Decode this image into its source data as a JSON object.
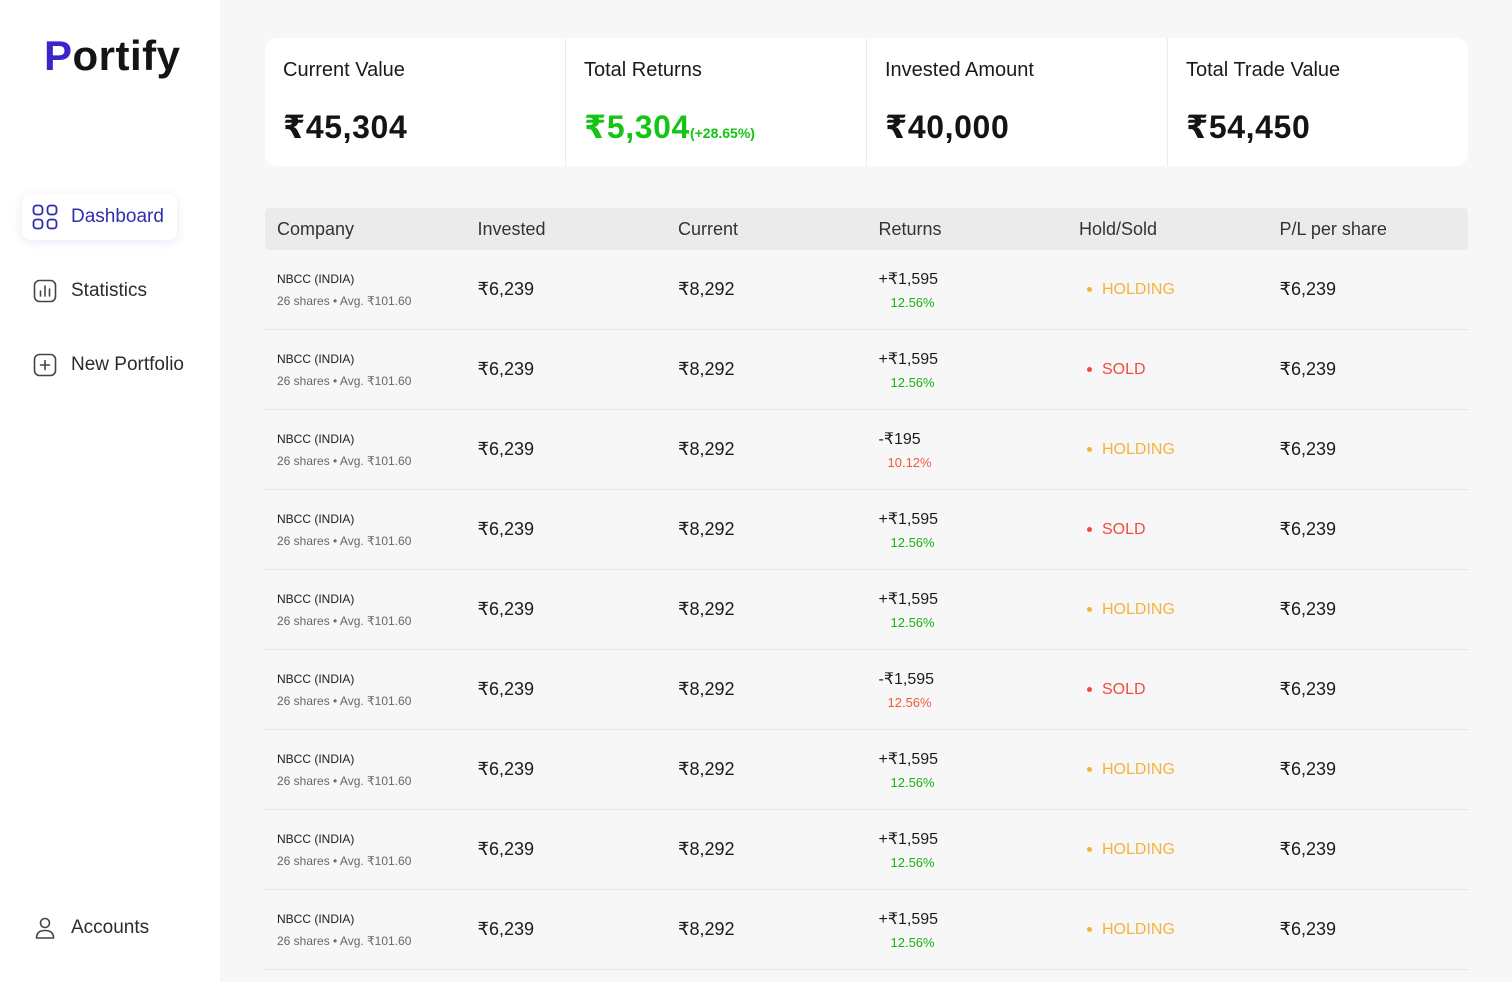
{
  "app": {
    "logo": "Portify",
    "logo_first": "P",
    "logo_rest": "ortify"
  },
  "sidebar": {
    "items": [
      {
        "label": "Dashboard",
        "icon": "grid-icon",
        "active": true
      },
      {
        "label": "Statistics",
        "icon": "bar-chart-icon",
        "active": false
      },
      {
        "label": "New Portfolio",
        "icon": "plus-square-icon",
        "active": false
      }
    ],
    "accounts": {
      "label": "Accounts",
      "icon": "user-icon"
    }
  },
  "summary": {
    "current_value": {
      "title": "Current Value",
      "value": "₹45,304"
    },
    "total_returns": {
      "title": "Total Returns",
      "value": "₹5,304",
      "percent": "(+28.65%)"
    },
    "invested_amount": {
      "title": "Invested Amount",
      "value": "₹40,000"
    },
    "total_trade_value": {
      "title": "Total Trade Value",
      "value": "₹54,450"
    }
  },
  "colors": {
    "accent": "#3b25c9",
    "positive": "#16c416",
    "negative": "#ef5a3c",
    "holding": "#f3b33d",
    "sold": "#ef4c3a"
  },
  "table": {
    "headers": [
      "Company",
      "Invested",
      "Current",
      "Returns",
      "Hold/Sold",
      "P/L per share"
    ],
    "rows": [
      {
        "company": "NBCC (INDIA)",
        "details": "26 shares • Avg. ₹101.60",
        "invested": "₹6,239",
        "current": "₹8,292",
        "returns": "+₹1,595",
        "returns_pct": "12.56%",
        "direction": "up",
        "status": "HOLDING",
        "pl": "₹6,239"
      },
      {
        "company": "NBCC (INDIA)",
        "details": "26 shares • Avg. ₹101.60",
        "invested": "₹6,239",
        "current": "₹8,292",
        "returns": "+₹1,595",
        "returns_pct": "12.56%",
        "direction": "up",
        "status": "SOLD",
        "pl": "₹6,239"
      },
      {
        "company": "NBCC (INDIA)",
        "details": "26 shares • Avg. ₹101.60",
        "invested": "₹6,239",
        "current": "₹8,292",
        "returns": "-₹195",
        "returns_pct": "10.12%",
        "direction": "down",
        "status": "HOLDING",
        "pl": "₹6,239"
      },
      {
        "company": "NBCC (INDIA)",
        "details": "26 shares • Avg. ₹101.60",
        "invested": "₹6,239",
        "current": "₹8,292",
        "returns": "+₹1,595",
        "returns_pct": "12.56%",
        "direction": "up",
        "status": "SOLD",
        "pl": "₹6,239"
      },
      {
        "company": "NBCC (INDIA)",
        "details": "26 shares • Avg. ₹101.60",
        "invested": "₹6,239",
        "current": "₹8,292",
        "returns": "+₹1,595",
        "returns_pct": "12.56%",
        "direction": "up",
        "status": "HOLDING",
        "pl": "₹6,239"
      },
      {
        "company": "NBCC (INDIA)",
        "details": "26 shares • Avg. ₹101.60",
        "invested": "₹6,239",
        "current": "₹8,292",
        "returns": "-₹1,595",
        "returns_pct": "12.56%",
        "direction": "down",
        "status": "SOLD",
        "pl": "₹6,239"
      },
      {
        "company": "NBCC (INDIA)",
        "details": "26 shares • Avg. ₹101.60",
        "invested": "₹6,239",
        "current": "₹8,292",
        "returns": "+₹1,595",
        "returns_pct": "12.56%",
        "direction": "up",
        "status": "HOLDING",
        "pl": "₹6,239"
      },
      {
        "company": "NBCC (INDIA)",
        "details": "26 shares • Avg. ₹101.60",
        "invested": "₹6,239",
        "current": "₹8,292",
        "returns": "+₹1,595",
        "returns_pct": "12.56%",
        "direction": "up",
        "status": "HOLDING",
        "pl": "₹6,239"
      },
      {
        "company": "NBCC (INDIA)",
        "details": "26 shares • Avg. ₹101.60",
        "invested": "₹6,239",
        "current": "₹8,292",
        "returns": "+₹1,595",
        "returns_pct": "12.56%",
        "direction": "up",
        "status": "HOLDING",
        "pl": "₹6,239"
      }
    ]
  }
}
